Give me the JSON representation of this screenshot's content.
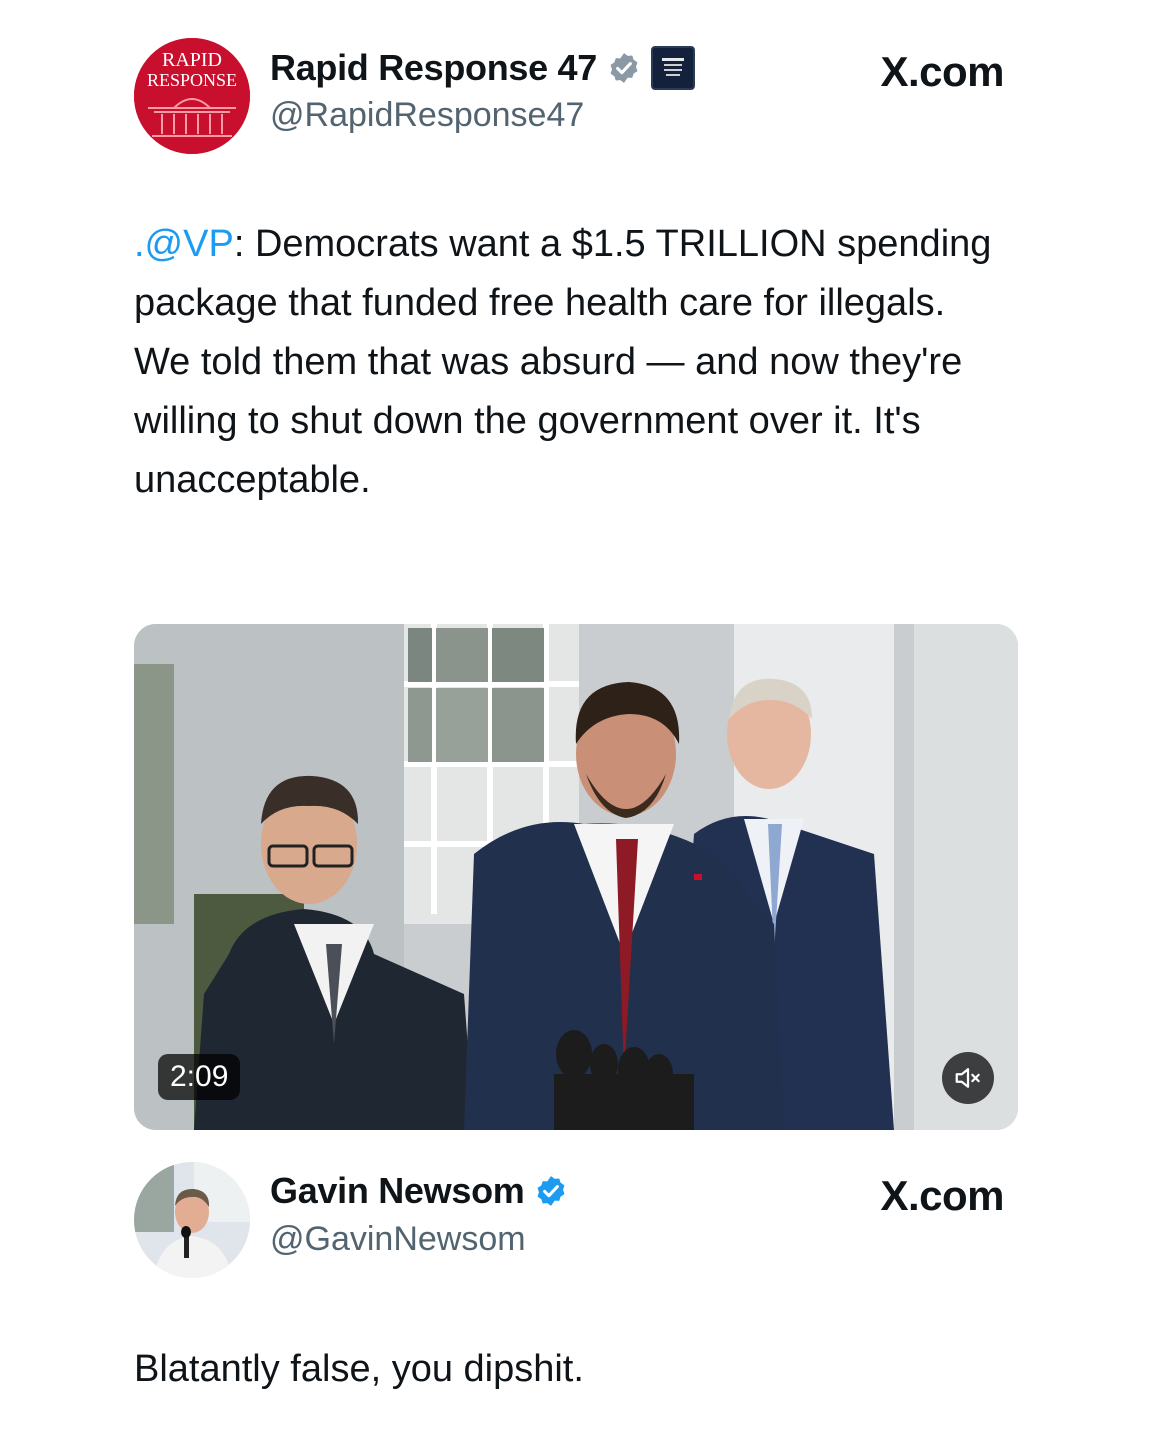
{
  "source_label": "X.com",
  "tweets": [
    {
      "display_name": "Rapid Response 47",
      "handle": "@RapidResponse47",
      "avatar_text_1": "RAPID",
      "avatar_text_2": "RESPONSE",
      "text_mention": ".@VP",
      "text_body": ": Democrats want a $1.5 TRILLION spending package that funded free health care for illegals. We told them that was absurd — and now they're willing to shut down the government over it. It's unacceptable.",
      "media": {
        "duration": "2:09",
        "icon": "speaker-muted-icon"
      }
    },
    {
      "display_name": "Gavin Newsom",
      "handle": "@GavinNewsom",
      "text_body": "Blatantly false, you dipshit."
    }
  ],
  "colors": {
    "verified": "#1d9bf0",
    "handle": "#536471",
    "brand_red": "#c8102e"
  }
}
